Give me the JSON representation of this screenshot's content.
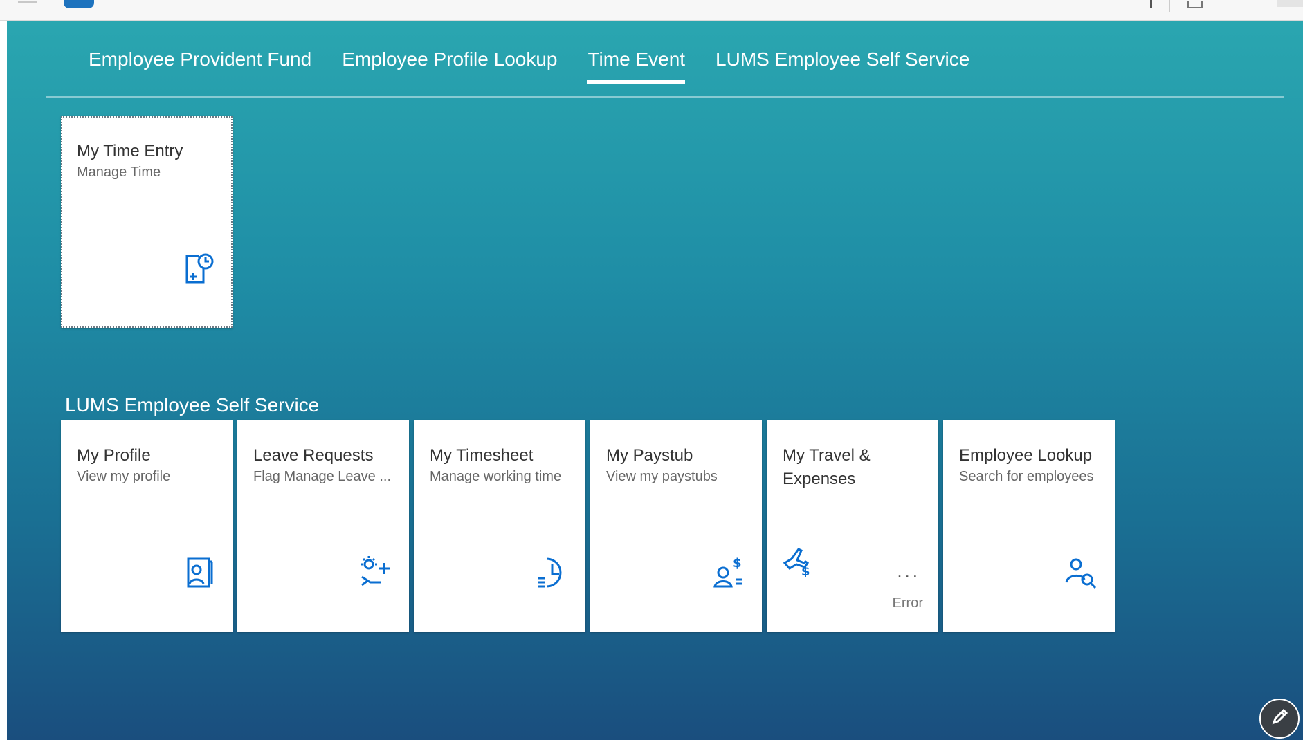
{
  "tabs": [
    {
      "label": "Employee Provident Fund",
      "active": false
    },
    {
      "label": "Employee Profile Lookup",
      "active": false
    },
    {
      "label": "Time Event",
      "active": true
    },
    {
      "label": "LUMS Employee Self Service",
      "active": false
    }
  ],
  "time_event_tiles": [
    {
      "title": "My Time Entry",
      "subtitle": "Manage Time",
      "icon": "time-entry-icon"
    }
  ],
  "group": {
    "title": "LUMS Employee Self Service"
  },
  "ess_tiles": [
    {
      "title": "My Profile",
      "subtitle": "View my profile",
      "icon": "profile-icon"
    },
    {
      "title": "Leave Requests",
      "subtitle": "Flag Manage Leave ...",
      "icon": "leave-request-icon"
    },
    {
      "title": "My Timesheet",
      "subtitle": "Manage working time",
      "icon": "timesheet-icon"
    },
    {
      "title": "My Paystub",
      "subtitle": "View my paystubs",
      "icon": "paystub-icon"
    },
    {
      "title": "My Travel & Expenses",
      "subtitle": "",
      "icon": "travel-expense-icon",
      "status": "Error",
      "more": "..."
    },
    {
      "title": "Employee Lookup",
      "subtitle": "Search for employees",
      "icon": "employee-search-icon"
    }
  ],
  "colors": {
    "accent": "#2aa6b0",
    "icon": "#0a6ed1",
    "tile_bg": "#ffffff"
  },
  "edit_button": {
    "icon": "pencil-icon"
  }
}
